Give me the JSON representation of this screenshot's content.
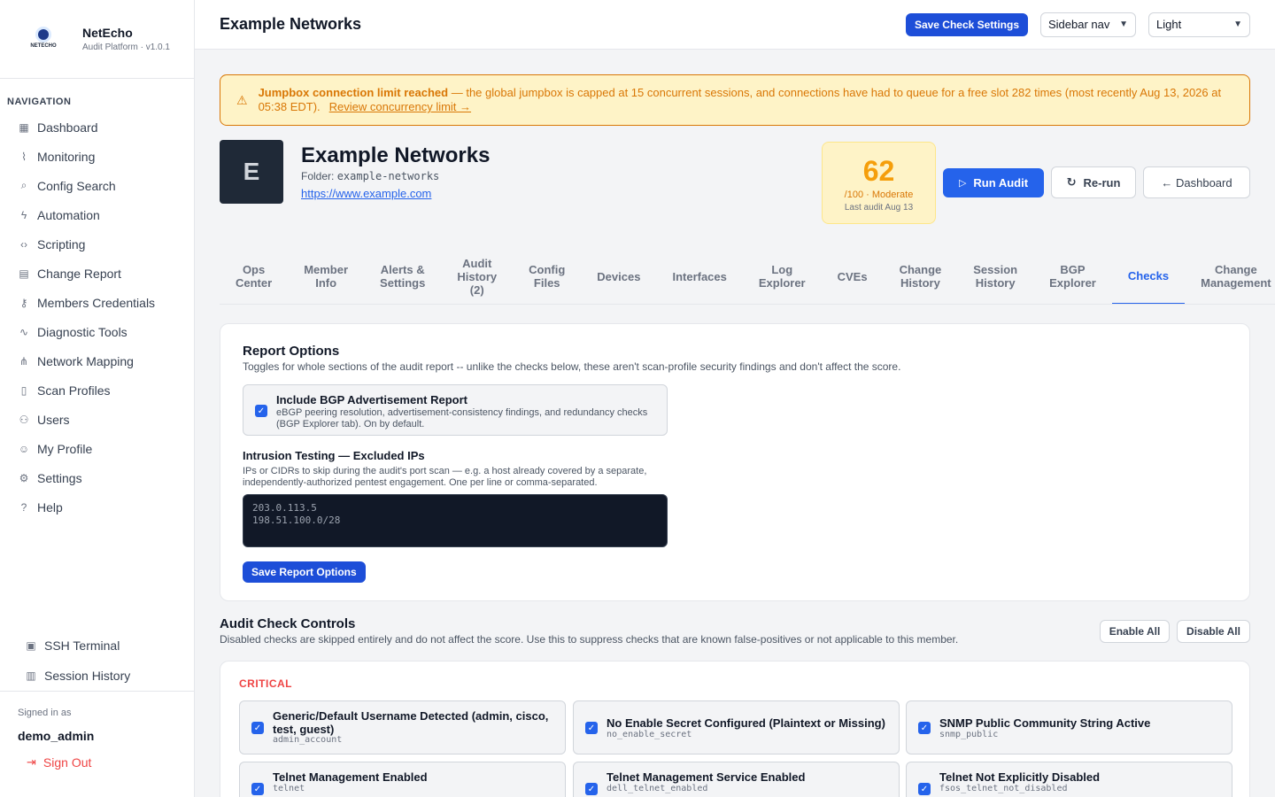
{
  "brand": {
    "name": "NetEcho",
    "subtitle": "Audit Platform · v1.0.1",
    "logo_text": "NETECHO"
  },
  "sidebar": {
    "heading": "NAVIGATION",
    "items": [
      {
        "label": "Dashboard",
        "icon": "grid-icon"
      },
      {
        "label": "Monitoring",
        "icon": "activity-icon"
      },
      {
        "label": "Config Search",
        "icon": "search-icon"
      },
      {
        "label": "Automation",
        "icon": "bolt-icon"
      },
      {
        "label": "Scripting",
        "icon": "code-icon"
      },
      {
        "label": "Change Report",
        "icon": "document-icon"
      },
      {
        "label": "Members Credentials",
        "icon": "key-icon"
      },
      {
        "label": "Diagnostic Tools",
        "icon": "pulse-icon"
      },
      {
        "label": "Network Mapping",
        "icon": "network-icon"
      },
      {
        "label": "Scan Profiles",
        "icon": "file-icon"
      },
      {
        "label": "Users",
        "icon": "users-icon"
      },
      {
        "label": "My Profile",
        "icon": "user-icon"
      },
      {
        "label": "Settings",
        "icon": "gear-icon"
      },
      {
        "label": "Help",
        "icon": "help-icon"
      }
    ],
    "bottom": [
      {
        "label": "SSH Terminal",
        "icon": "terminal-icon"
      },
      {
        "label": "Session History",
        "icon": "clipboard-icon"
      }
    ],
    "signed_in_label": "Signed in as",
    "username": "demo_admin",
    "sign_out": "Sign Out"
  },
  "topbar": {
    "title": "Example Networks",
    "save_button": "Save Check Settings",
    "nav_select": "Sidebar nav",
    "theme_select": "Light"
  },
  "alert": {
    "title": "Jumpbox connection limit reached",
    "body": " — the global jumpbox is capped at 15 concurrent sessions, and connections have had to queue for a free slot 282 times (most recently Aug 13, 2026 at 05:38 EDT).",
    "link": "Review concurrency limit →"
  },
  "member": {
    "initial": "E",
    "name": "Example Networks",
    "folder_label": "Folder: ",
    "folder": "example-networks",
    "url": "https://www.example.com"
  },
  "score": {
    "value": "62",
    "label": "/100 · Moderate",
    "last_audit": "Last audit Aug 13"
  },
  "actions": {
    "run": "Run Audit",
    "rerun": "Re-run",
    "dashboard": "← Dashboard"
  },
  "tabs": [
    {
      "label": "Ops\nCenter"
    },
    {
      "label": "Member\nInfo"
    },
    {
      "label": "Alerts &\nSettings"
    },
    {
      "label": "Audit\nHistory\n(2)"
    },
    {
      "label": "Config\nFiles"
    },
    {
      "label": "Devices"
    },
    {
      "label": "Interfaces"
    },
    {
      "label": "Log\nExplorer"
    },
    {
      "label": "CVEs"
    },
    {
      "label": "Change\nHistory"
    },
    {
      "label": "Session\nHistory"
    },
    {
      "label": "BGP\nExplorer"
    },
    {
      "label": "Checks",
      "active": true
    },
    {
      "label": "Change\nManagement"
    }
  ],
  "report_options": {
    "title": "Report Options",
    "description": "Toggles for whole sections of the audit report -- unlike the checks below, these aren't scan-profile security findings and don't affect the score.",
    "bgp_title": "Include BGP Advertisement Report",
    "bgp_desc": "eBGP peering resolution, advertisement-consistency findings, and redundancy checks (BGP Explorer tab). On by default.",
    "intrusion_title": "Intrusion Testing — Excluded IPs",
    "intrusion_desc": "IPs or CIDRs to skip during the audit's port scan — e.g. a host already covered by a separate, independently-authorized pentest engagement. One per line or comma-separated.",
    "excluded_ips": "203.0.113.5\n198.51.100.0/28",
    "save": "Save Report Options"
  },
  "audit_controls": {
    "title": "Audit Check Controls",
    "description": "Disabled checks are skipped entirely and do not affect the score. Use this to suppress checks that are known false-positives or not applicable to this member.",
    "enable_all": "Enable All",
    "disable_all": "Disable All",
    "severity": "CRITICAL",
    "checks": [
      {
        "title": "Generic/Default Username Detected (admin, cisco, test, guest)",
        "code": "admin_account"
      },
      {
        "title": "No Enable Secret Configured (Plaintext or Missing)",
        "code": "no_enable_secret"
      },
      {
        "title": "SNMP Public Community String Active",
        "code": "snmp_public"
      },
      {
        "title": "Telnet Management Enabled",
        "code": "telnet"
      },
      {
        "title": "Telnet Management Service Enabled",
        "code": "dell_telnet_enabled"
      },
      {
        "title": "Telnet Not Explicitly Disabled",
        "code": "fsos_telnet_not_disabled"
      }
    ]
  }
}
